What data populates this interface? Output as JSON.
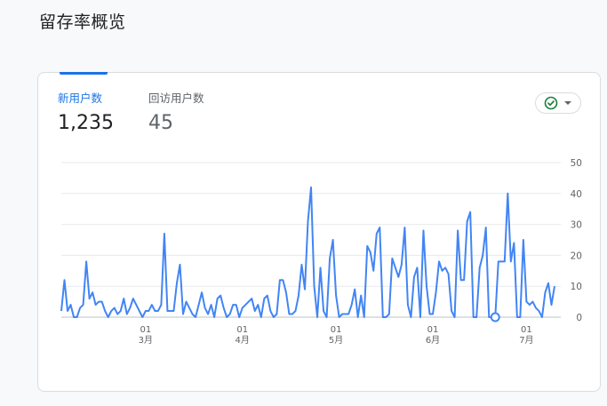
{
  "page": {
    "title": "留存率概览"
  },
  "metrics": [
    {
      "label": "新用户数",
      "value": "1,235"
    },
    {
      "label": "回访用户数",
      "value": "45"
    }
  ],
  "compare_button": {
    "icon": "check-circle-icon",
    "caret": "caret-down-icon"
  },
  "colors": {
    "series": "#4285f4",
    "accent": "#1a73e8",
    "check": "#188038"
  },
  "chart_data": {
    "type": "line",
    "series": [
      {
        "values": [
          2,
          12,
          2,
          4,
          0,
          0,
          3,
          4,
          18,
          6,
          8,
          4,
          5,
          5,
          2,
          0,
          2,
          3,
          1,
          2,
          6,
          1,
          3,
          6,
          4,
          2,
          0,
          2,
          2,
          4,
          2,
          2,
          4,
          27,
          2,
          2,
          2,
          11,
          17,
          1,
          5,
          3,
          1,
          0,
          4,
          8,
          3,
          1,
          4,
          0,
          6,
          7,
          3,
          0,
          1,
          4,
          4,
          0,
          3,
          4,
          5,
          6,
          2,
          4,
          0,
          6,
          7,
          2,
          0,
          1,
          12,
          12,
          8,
          1,
          1,
          2,
          7,
          17,
          9,
          31,
          42,
          10,
          0,
          16,
          2,
          0,
          19,
          25,
          7,
          0,
          1,
          1,
          1,
          4,
          9,
          0,
          7,
          0,
          23,
          21,
          15,
          27,
          29,
          0,
          0,
          1,
          19,
          16,
          13,
          17,
          29,
          4,
          0,
          13,
          16,
          0,
          28,
          10,
          1,
          1,
          8,
          18,
          15,
          16,
          14,
          2,
          0,
          28,
          12,
          12,
          31,
          34,
          0,
          0,
          16,
          20,
          29,
          0,
          0,
          0,
          18,
          18,
          18,
          40,
          18,
          24,
          0,
          0,
          25,
          5,
          4,
          5,
          3,
          2,
          0,
          8,
          11,
          4,
          10
        ]
      }
    ],
    "y_ticks": [
      0,
      10,
      20,
      30,
      40,
      50
    ],
    "ylim": [
      0,
      50
    ],
    "x_ticks": [
      {
        "line1": "01",
        "line2": "3月",
        "index": 27
      },
      {
        "line1": "01",
        "line2": "4月",
        "index": 58
      },
      {
        "line1": "01",
        "line2": "5月",
        "index": 88
      },
      {
        "line1": "01",
        "line2": "6月",
        "index": 119
      },
      {
        "line1": "01",
        "line2": "7月",
        "index": 149
      }
    ],
    "highlight_index": 139
  }
}
